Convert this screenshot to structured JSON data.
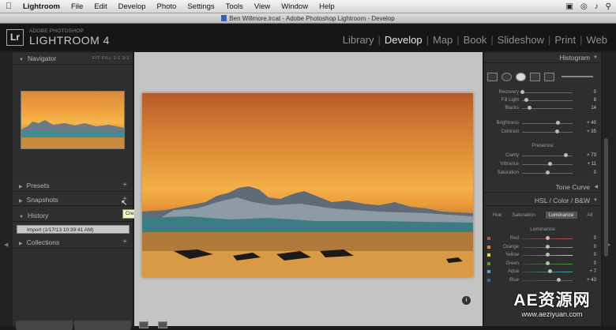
{
  "menubar": {
    "app_name": "Lightroom",
    "items": [
      "File",
      "Edit",
      "Develop",
      "Photo",
      "Settings",
      "Tools",
      "View",
      "Window",
      "Help"
    ]
  },
  "titlebar": {
    "title": "Ben Willmore.lrcat - Adobe Photoshop Lightroom - Develop"
  },
  "identity": {
    "logo": "Lr",
    "brand_line1": "ADOBE PHOTOSHOP",
    "brand_line2": "LIGHTROOM 4"
  },
  "modules": [
    "Library",
    "Develop",
    "Map",
    "Book",
    "Slideshow",
    "Print",
    "Web"
  ],
  "active_module": "Develop",
  "left_panel": {
    "navigator": {
      "title": "Navigator",
      "modes": "FIT  FILL  1:1  3:1"
    },
    "presets": {
      "title": "Presets"
    },
    "snapshots": {
      "title": "Snapshots"
    },
    "snapshot_tooltip": "Create Snapshot",
    "history": {
      "title": "History",
      "items": [
        "Import (1/17/13 10:39:41 AM)"
      ]
    },
    "collections": {
      "title": "Collections"
    }
  },
  "right_panel": {
    "histogram_title": "Histogram",
    "basic_sliders": [
      {
        "label": "Recovery",
        "value": "0",
        "pos": 0.0
      },
      {
        "label": "Fill Light",
        "value": "8",
        "pos": 0.08
      },
      {
        "label": "Blacks",
        "value": "14",
        "pos": 0.14
      },
      {
        "label": "Brightness",
        "value": "+ 40",
        "pos": 0.7
      },
      {
        "label": "Contrast",
        "value": "+ 35",
        "pos": 0.68
      }
    ],
    "presence_title": "Presence",
    "presence_sliders": [
      {
        "label": "Clarity",
        "value": "+ 73",
        "pos": 0.86
      },
      {
        "label": "Vibrance",
        "value": "+ 11",
        "pos": 0.55
      },
      {
        "label": "Saturation",
        "value": "0",
        "pos": 0.5
      }
    ],
    "tone_curve_title": "Tone Curve",
    "hsl_title": "HSL / Color / B&W",
    "hsl_tabs": [
      "Hue",
      "Saturation",
      "Luminance",
      "All"
    ],
    "hsl_active_tab": "Luminance",
    "luminance_title": "Luminance",
    "luminance_sliders": [
      {
        "label": "Red",
        "value": "0",
        "pos": 0.5,
        "color": "#c0504d"
      },
      {
        "label": "Orange",
        "value": "0",
        "pos": 0.5,
        "color": "#e38a3a"
      },
      {
        "label": "Yellow",
        "value": "0",
        "pos": 0.5,
        "color": "#e6d43c"
      },
      {
        "label": "Green",
        "value": "0",
        "pos": 0.5,
        "color": "#4e9a3e"
      },
      {
        "label": "Aqua",
        "value": "+ 7",
        "pos": 0.54,
        "color": "#3fb0b5"
      },
      {
        "label": "Blue",
        "value": "+ 43",
        "pos": 0.72,
        "color": "#3a5fc0"
      }
    ]
  },
  "watermark": {
    "line1": "AE资源网",
    "line2": "www.aeziyuan.com"
  }
}
